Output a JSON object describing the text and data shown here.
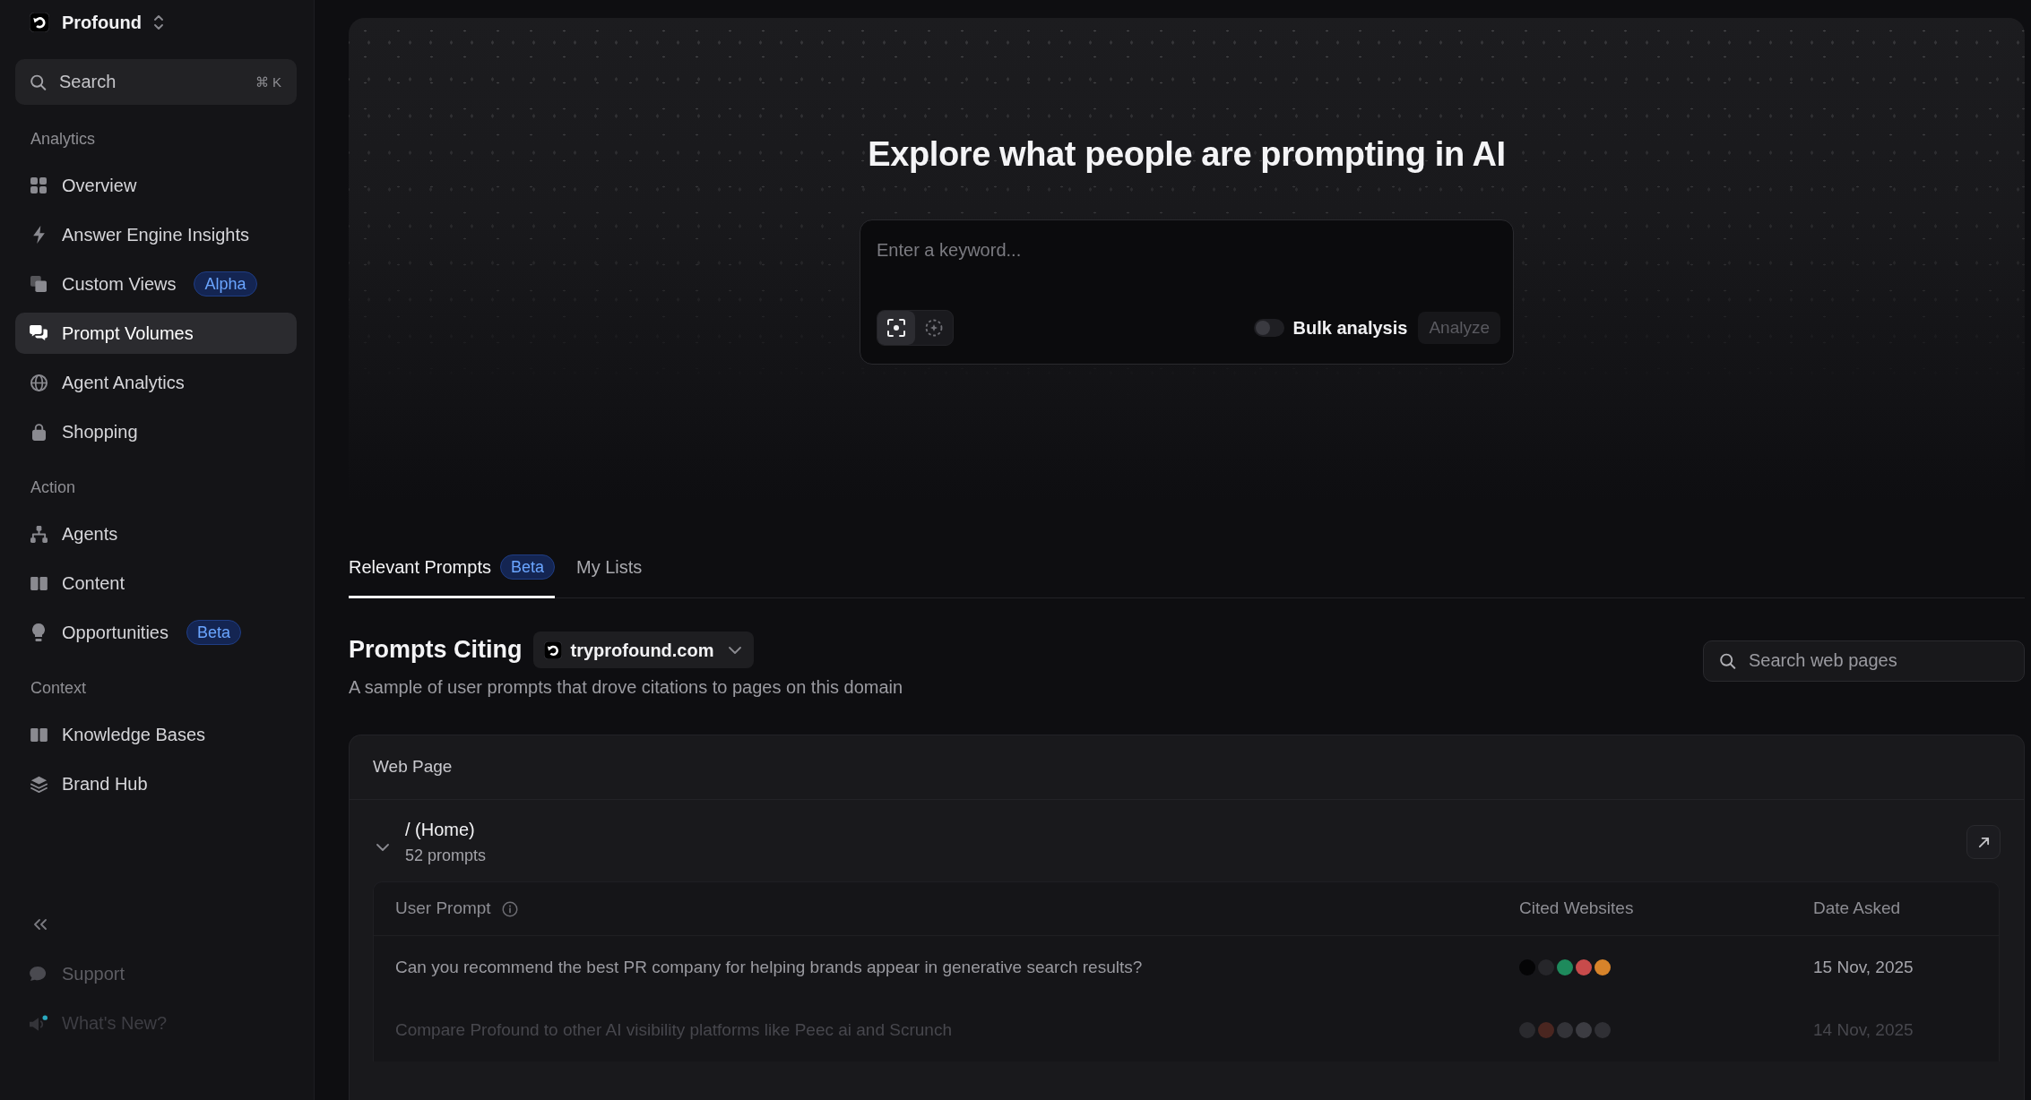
{
  "sidebar": {
    "workspace": "Profound",
    "search": {
      "placeholder": "Search",
      "shortcut": "⌘ K"
    },
    "sections": [
      {
        "title": "Analytics",
        "items": [
          {
            "label": "Overview",
            "selected": false
          },
          {
            "label": "Answer Engine Insights",
            "selected": false
          },
          {
            "label": "Custom Views",
            "badge": "Alpha",
            "selected": false
          },
          {
            "label": "Prompt Volumes",
            "selected": true
          },
          {
            "label": "Agent Analytics",
            "selected": false
          },
          {
            "label": "Shopping",
            "selected": false
          }
        ]
      },
      {
        "title": "Action",
        "items": [
          {
            "label": "Agents",
            "selected": false
          },
          {
            "label": "Content",
            "selected": false
          },
          {
            "label": "Opportunities",
            "badge": "Beta",
            "selected": false
          }
        ]
      },
      {
        "title": "Context",
        "items": [
          {
            "label": "Knowledge Bases",
            "selected": false
          },
          {
            "label": "Brand Hub",
            "selected": false
          }
        ]
      }
    ],
    "footer_items": [
      {
        "label": "Support",
        "unread": false
      },
      {
        "label": "What's New?",
        "unread": true
      }
    ]
  },
  "hero": {
    "title": "Explore what people are prompting in AI",
    "keyword_input": {
      "placeholder": "Enter a keyword..."
    },
    "modes": [
      {
        "selected": true
      },
      {
        "selected": false
      }
    ],
    "bulk_analysis": {
      "label": "Bulk analysis",
      "on": false
    },
    "analyze_button": {
      "label": "Analyze",
      "disabled": true
    }
  },
  "tabs": [
    {
      "label": "Relevant Prompts",
      "badge": "Beta",
      "selected": true
    },
    {
      "label": "My Lists",
      "selected": false
    }
  ],
  "prompts_citing": {
    "title": "Prompts Citing",
    "domain": "tryprofound.com",
    "description": "A sample of user prompts that drove citations to pages on this domain",
    "search": {
      "placeholder": "Search web pages"
    }
  },
  "web_pages": {
    "column": "Web Page",
    "groups": [
      {
        "title": "/ (Home)",
        "count": "52 prompts",
        "expanded": true,
        "columns": [
          "User Prompt",
          "Cited Websites",
          "Date Asked"
        ],
        "rows": [
          {
            "prompt": "Can you recommend the best PR company for helping brands appear in generative search results?",
            "sites": [
              {
                "color": "#050506"
              },
              {
                "color": "#26262a"
              },
              {
                "color": "#1e8a5c"
              },
              {
                "color": "#c84b4b"
              },
              {
                "color": "#d7832a"
              }
            ],
            "date": "15 Nov, 2025"
          },
          {
            "prompt": "Compare Profound to other AI visibility platforms like Peec ai and Scrunch",
            "sites": [
              {
                "color": "#2a2a2e"
              },
              {
                "color": "#4a2620"
              },
              {
                "color": "#333338"
              },
              {
                "color": "#3c3c42"
              },
              {
                "color": "#2f2f34"
              }
            ],
            "date": "14 Nov, 2025"
          }
        ]
      }
    ]
  }
}
